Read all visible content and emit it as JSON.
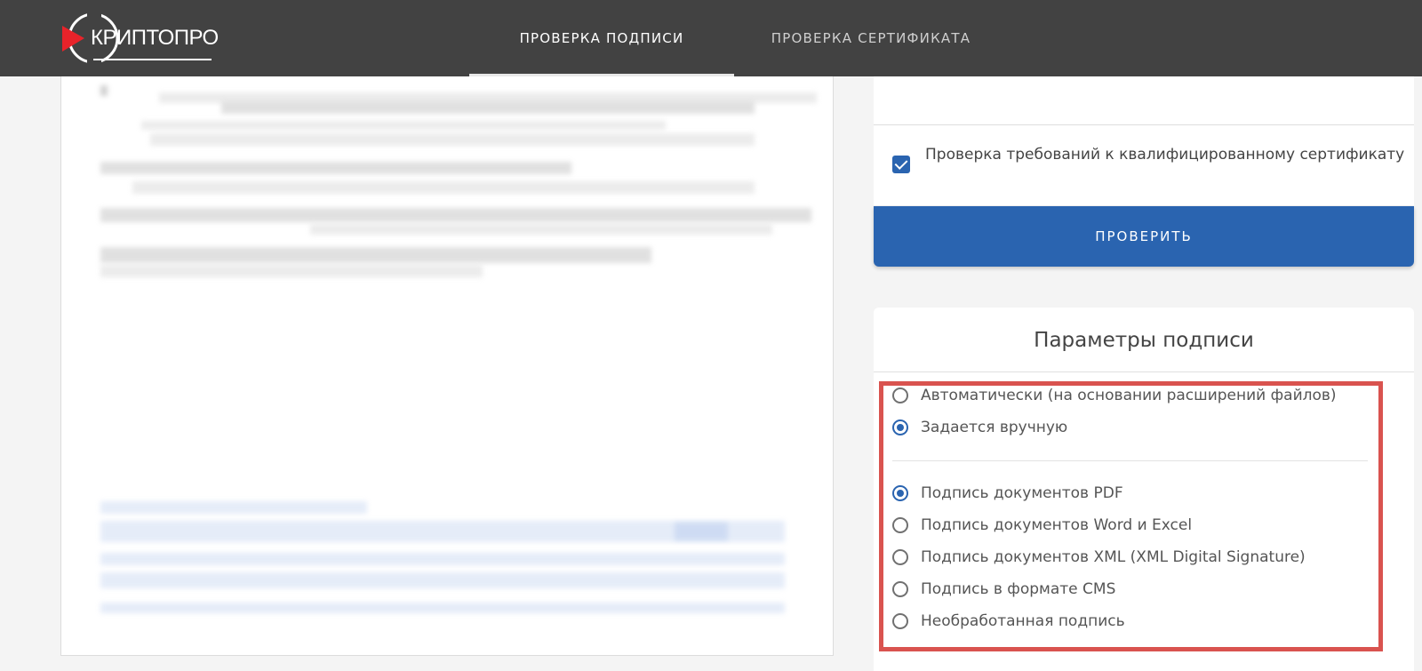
{
  "header": {
    "logo_text": "КРИПТОПРО",
    "tabs": [
      {
        "label": "ПРОВЕРКА ПОДПИСИ",
        "active": true
      },
      {
        "label": "ПРОВЕРКА СЕРТИФИКАТА",
        "active": false
      }
    ]
  },
  "check": {
    "qualified_label": "Проверка требований к квалифицированному сертификату",
    "qualified_checked": true,
    "verify_button": "ПРОВЕРИТЬ"
  },
  "params": {
    "title": "Параметры подписи",
    "mode_options": [
      {
        "label": "Автоматически (на основании расширений файлов)",
        "checked": false
      },
      {
        "label": "Задается вручную",
        "checked": true
      }
    ],
    "format_options": [
      {
        "label": "Подпись документов PDF",
        "checked": true
      },
      {
        "label": "Подпись документов Word и Excel",
        "checked": false
      },
      {
        "label": "Подпись документов XML (XML Digital Signature)",
        "checked": false
      },
      {
        "label": "Подпись в формате CMS",
        "checked": false
      },
      {
        "label": "Необработанная подпись",
        "checked": false
      }
    ]
  },
  "colors": {
    "header_bg": "#424242",
    "accent": "#2a64b0",
    "highlight": "#d9534f",
    "logo_red": "#e8232a"
  }
}
